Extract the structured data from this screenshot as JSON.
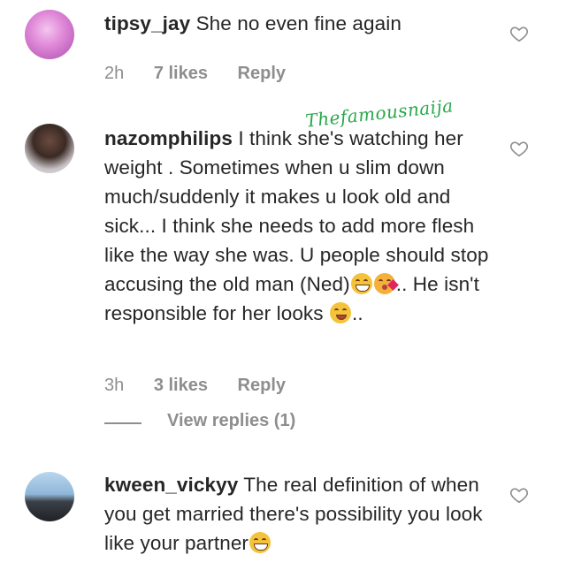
{
  "comments": [
    {
      "username": "tipsy_jay",
      "text": "She no even fine again",
      "time": "2h",
      "likes": "7 likes",
      "reply": "Reply"
    },
    {
      "username": "nazomphilips",
      "text_part1": "I think she's watching her weight . Sometimes when u slim down much/suddenly it makes u look old and sick... I think she needs to add more flesh like the way she was. U people should stop accusing the old man (Ned)",
      "text_part2": ".. He isn't responsible for her looks",
      "text_part3": "..",
      "time": "3h",
      "likes": "3 likes",
      "reply": "Reply",
      "view_replies": "View replies (1)"
    },
    {
      "username": "kween_vickyy",
      "text": "The real definition of when you get married there's possibility you look like your partner",
      "time": "",
      "likes": "",
      "reply": ""
    }
  ],
  "watermark": "Thefamousnaija",
  "icons": {
    "like": "heart-outline-icon",
    "emoji_laugh": "grinning-squinting-face-emoji",
    "emoji_kiss": "face-blowing-kiss-emoji",
    "emoji_wink": "winking-face-tongue-emoji"
  },
  "colors": {
    "text": "#262626",
    "meta": "#8e8e8e",
    "watermark": "#27a84a"
  }
}
